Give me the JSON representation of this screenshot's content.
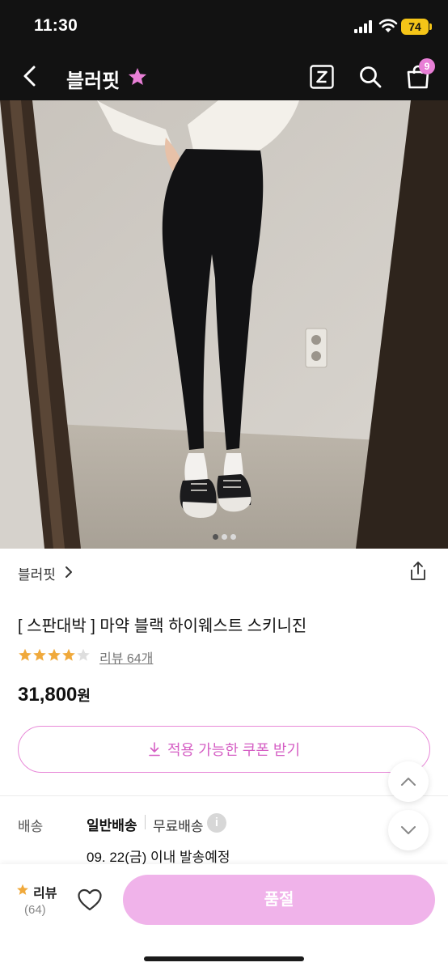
{
  "status_bar": {
    "time": "11:30",
    "battery": "74"
  },
  "nav": {
    "title": "블러핏",
    "cart_count": "9"
  },
  "gallery": {
    "total_images": 3,
    "current_index": 1
  },
  "product": {
    "brand": "블러핏",
    "name": "[ 스판대박 ] 마약 블랙 하이웨스트 스키니진",
    "rating": 4.5,
    "review_link": "리뷰 64개",
    "price": "31,800",
    "currency": "원"
  },
  "coupon": {
    "label": "적용 가능한 쿠폰 받기"
  },
  "shipping": {
    "label": "배송",
    "type": "일반배송",
    "fee": "무료배송",
    "info_icon": "i",
    "date": "09. 22(금) 이내 발송예정"
  },
  "bottom_bar": {
    "review_label": "리뷰",
    "review_count": "(64)",
    "buy_label": "품절"
  },
  "colors": {
    "accent": "#e87fd6",
    "buy_button": "#f0b3ea",
    "star": "#f0a93b",
    "nav_bg": "#121212"
  },
  "icons": [
    "back-icon",
    "star-icon",
    "z-icon",
    "search-icon",
    "bag-icon",
    "chevron-right-icon",
    "share-icon",
    "download-icon",
    "info-icon",
    "chevron-up-icon",
    "chevron-down-icon",
    "heart-icon"
  ]
}
